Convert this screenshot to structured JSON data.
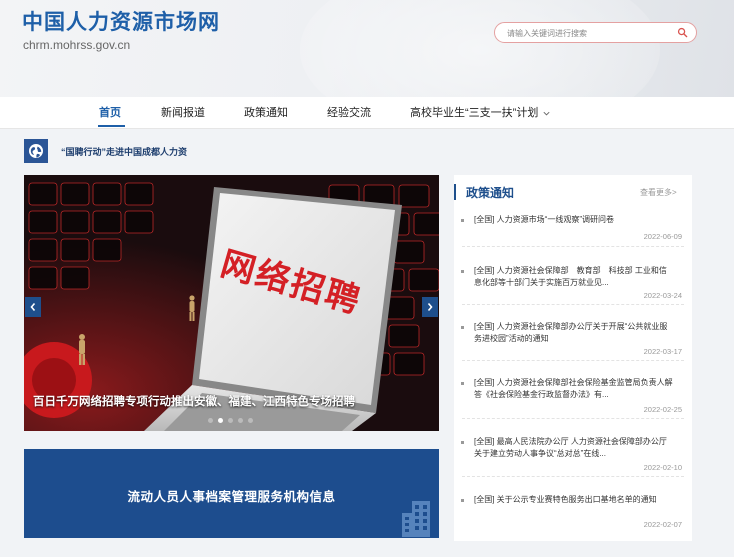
{
  "header": {
    "site_title": "中国人力资源市场网",
    "site_domain": "chrm.mohrss.gov.cn",
    "search_placeholder": "请输入关键词进行搜索"
  },
  "nav": {
    "items": [
      {
        "label": "首页"
      },
      {
        "label": "新闻报道"
      },
      {
        "label": "政策通知"
      },
      {
        "label": "经验交流"
      },
      {
        "label": "高校毕业生“三支一扶”计划"
      }
    ]
  },
  "notice": {
    "text": "“国聘行动”走进中国成都人力资"
  },
  "carousel": {
    "screen_text": "网络招聘",
    "caption": "百日千万网络招聘专项行动推出安徽、福建、江西特色专场招聘",
    "active_slide": 1,
    "slide_count": 5
  },
  "banner": {
    "text": "流动人员人事档案管理服务机构信息"
  },
  "policy": {
    "title": "政策通知",
    "more": "查看更多>",
    "items": [
      {
        "text": "[全国] 人力资源市场“一线观察”调研问卷",
        "date": "2022-06-09"
      },
      {
        "text": "[全国] 人力资源社会保障部　教育部　科技部 工业和信息化部等十部门关于实施百万就业见...",
        "date": "2022-03-24"
      },
      {
        "text": "[全国] 人力资源社会保障部办公厅关于开展“公共就业服务进校园”活动的通知",
        "date": "2022-03-17"
      },
      {
        "text": "[全国] 人力资源社会保障部社会保险基金监管局负责人解答《社会保险基金行政监督办法》有...",
        "date": "2022-02-25"
      },
      {
        "text": "[全国] 最高人民法院办公厅 人力资源社会保障部办公厅关于建立劳动人事争议“总对总”在线...",
        "date": "2022-02-10"
      },
      {
        "text": "[全国] 关于公示专业赛特色服务出口基地名单的通知",
        "date": "2022-02-07"
      }
    ]
  }
}
